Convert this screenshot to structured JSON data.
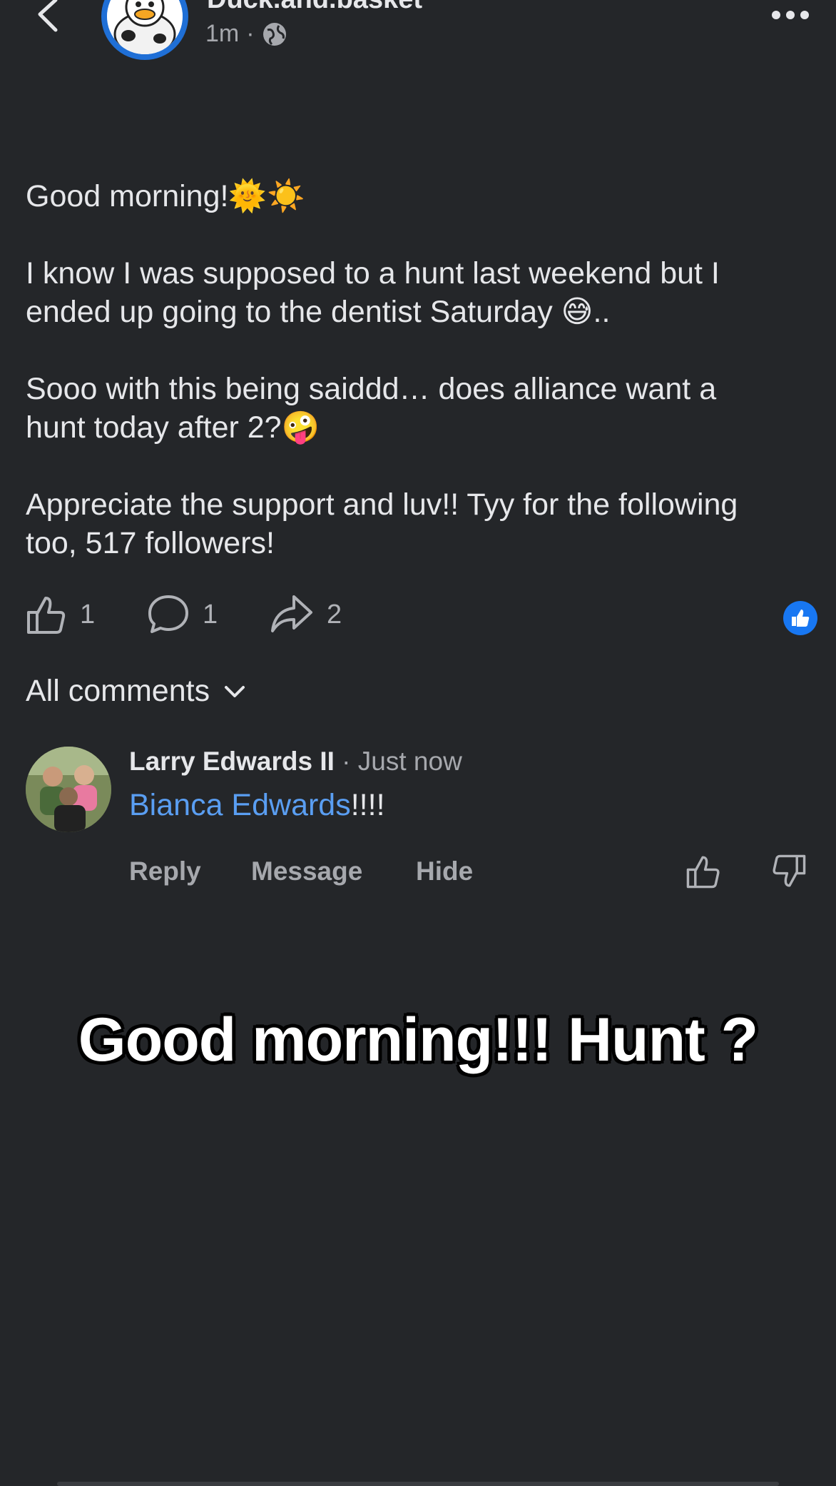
{
  "header": {
    "page_name": "Duck.and.basket",
    "timestamp": "1m",
    "separator": "·",
    "privacy_icon": "globe-icon",
    "back_icon": "chevron-left-icon",
    "more_icon": "more-horizontal-icon"
  },
  "post": {
    "paragraphs": [
      "Good morning!🌞☀️",
      "I know I was supposed to a hunt last weekend but I\nended up going to the dentist Saturday 😅..",
      "Sooo with this being saiddd… does alliance want a\nhunt today after 2?🤪",
      "Appreciate the support and luv!! Tyy for the following\ntoo, 517 followers!"
    ]
  },
  "actions": {
    "like_count": "1",
    "comment_count": "1",
    "share_count": "2"
  },
  "comments": {
    "header_label": "All comments",
    "items": [
      {
        "author": "Larry Edwards II",
        "time": " · Just now",
        "mention": "Bianca Edwards",
        "text": "!!!!",
        "reply_label": "Reply",
        "message_label": "Message",
        "hide_label": "Hide"
      }
    ]
  },
  "caption": "Good morning!!! Hunt ?",
  "colors": {
    "background": "#242629",
    "accent": "#1877f2",
    "mention": "#5a9ef2"
  }
}
